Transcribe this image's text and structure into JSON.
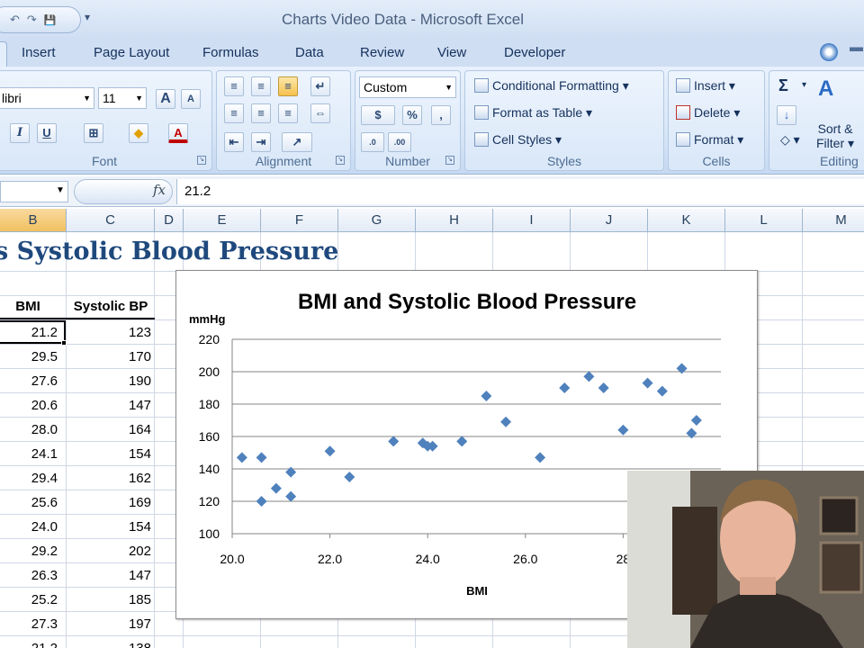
{
  "window": {
    "title": "Charts Video Data - Microsoft Excel"
  },
  "qat": {
    "undo": "↶",
    "redo": "↷",
    "save": "💾",
    "more": "▾"
  },
  "ribbon_tabs": [
    "Insert",
    "Page Layout",
    "Formulas",
    "Data",
    "Review",
    "View",
    "Developer"
  ],
  "ribbon": {
    "font": {
      "family": "libri",
      "size": "11",
      "label": "Font",
      "grow": "A",
      "shrink": "A",
      "italic": "I",
      "underline": "U",
      "font_color": "A"
    },
    "alignment": {
      "label": "Alignment"
    },
    "number": {
      "format": "Custom",
      "label": "Number",
      "currency": "$",
      "percent": "%",
      "comma": ",",
      "inc_dec": ".0→.00",
      "dec_dec": ".00→.0"
    },
    "styles": {
      "conditional": "Conditional Formatting",
      "format_table": "Format as Table",
      "cell_styles": "Cell Styles",
      "label": "Styles"
    },
    "cells": {
      "insert": "Insert",
      "delete": "Delete",
      "format": "Format",
      "label": "Cells"
    },
    "editing": {
      "sigma": "Σ",
      "sort": "Sort &",
      "filter": "Filter",
      "label": "Editing"
    }
  },
  "formula_bar": {
    "fx": "fx",
    "value": "21.2"
  },
  "columns": [
    "B",
    "C",
    "D",
    "E",
    "F",
    "G",
    "H",
    "I",
    "J",
    "K",
    "L",
    "M"
  ],
  "sheet": {
    "title": "s Systolic Blood Pressure",
    "headers": {
      "bmi": "BMI",
      "sbp": "Systolic BP"
    },
    "rows": [
      {
        "bmi": "21.2",
        "sbp": "123"
      },
      {
        "bmi": "29.5",
        "sbp": "170"
      },
      {
        "bmi": "27.6",
        "sbp": "190"
      },
      {
        "bmi": "20.6",
        "sbp": "147"
      },
      {
        "bmi": "28.0",
        "sbp": "164"
      },
      {
        "bmi": "24.1",
        "sbp": "154"
      },
      {
        "bmi": "29.4",
        "sbp": "162"
      },
      {
        "bmi": "25.6",
        "sbp": "169"
      },
      {
        "bmi": "24.0",
        "sbp": "154"
      },
      {
        "bmi": "29.2",
        "sbp": "202"
      },
      {
        "bmi": "26.3",
        "sbp": "147"
      },
      {
        "bmi": "25.2",
        "sbp": "185"
      },
      {
        "bmi": "27.3",
        "sbp": "197"
      },
      {
        "bmi": "21.2",
        "sbp": "138"
      }
    ]
  },
  "chart_data": {
    "type": "scatter",
    "title": "BMI and Systolic Blood Pressure",
    "xlabel": "BMI",
    "ylabel": "mmHg",
    "xlim": [
      20,
      30
    ],
    "ylim": [
      100,
      220
    ],
    "x_ticks": [
      "20.0",
      "22.0",
      "24.0",
      "26.0",
      "28"
    ],
    "y_ticks": [
      "100",
      "120",
      "140",
      "160",
      "180",
      "200",
      "220"
    ],
    "grid": true,
    "legend": "none",
    "marker_color": "#4f81bd",
    "points": [
      {
        "x": 20.2,
        "y": 147
      },
      {
        "x": 20.6,
        "y": 147
      },
      {
        "x": 20.6,
        "y": 120
      },
      {
        "x": 20.9,
        "y": 128
      },
      {
        "x": 21.2,
        "y": 138
      },
      {
        "x": 21.2,
        "y": 123
      },
      {
        "x": 22.0,
        "y": 151
      },
      {
        "x": 22.4,
        "y": 135
      },
      {
        "x": 23.3,
        "y": 157
      },
      {
        "x": 23.9,
        "y": 156
      },
      {
        "x": 24.0,
        "y": 154
      },
      {
        "x": 24.1,
        "y": 154
      },
      {
        "x": 24.7,
        "y": 157
      },
      {
        "x": 25.2,
        "y": 185
      },
      {
        "x": 25.6,
        "y": 169
      },
      {
        "x": 26.3,
        "y": 147
      },
      {
        "x": 26.8,
        "y": 190
      },
      {
        "x": 27.3,
        "y": 197
      },
      {
        "x": 27.6,
        "y": 190
      },
      {
        "x": 28.0,
        "y": 164
      },
      {
        "x": 28.5,
        "y": 193
      },
      {
        "x": 28.8,
        "y": 188
      },
      {
        "x": 29.2,
        "y": 202
      },
      {
        "x": 29.4,
        "y": 162
      },
      {
        "x": 29.5,
        "y": 170
      }
    ]
  }
}
